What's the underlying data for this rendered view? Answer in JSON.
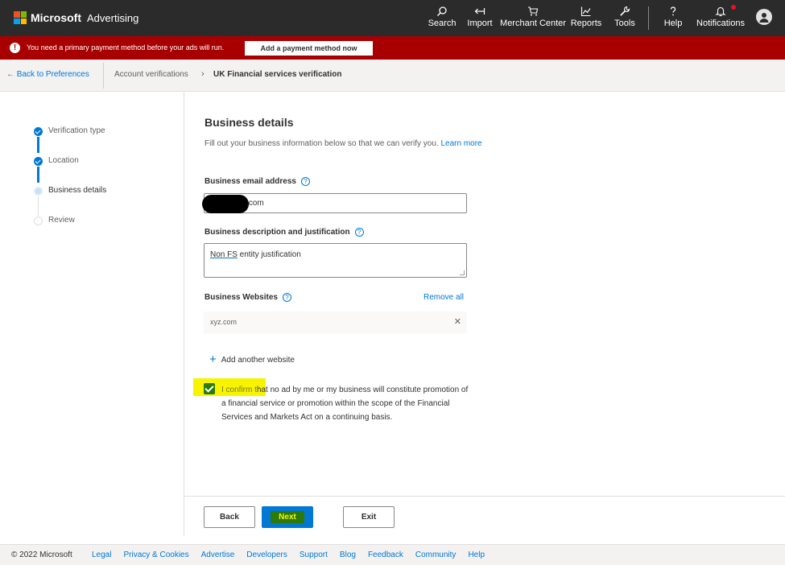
{
  "app": {
    "brand_ms": "Microsoft",
    "brand_product": "Advertising",
    "logo_colors": [
      "#f25022",
      "#7fba00",
      "#00a4ef",
      "#ffb900"
    ]
  },
  "nav": {
    "search": {
      "label": "Search",
      "icon": "search-icon"
    },
    "import": {
      "label": "Import",
      "icon": "import-icon"
    },
    "merchant": {
      "label": "Merchant Center",
      "icon": "cart-icon"
    },
    "reports": {
      "label": "Reports",
      "icon": "chart-icon"
    },
    "tools": {
      "label": "Tools",
      "icon": "wrench-icon"
    },
    "help": {
      "label": "Help",
      "icon": "question-icon"
    },
    "notifications": {
      "label": "Notifications",
      "icon": "bell-icon"
    }
  },
  "alert": {
    "message": "You need a primary payment method before your ads will run.",
    "button_label": "Add a payment method now",
    "color": "#a80000"
  },
  "breadcrumb": {
    "back_label": "Back to Preferences",
    "parent": "Account verifications",
    "current": "UK Financial services verification"
  },
  "steps": {
    "s1": "Verification type",
    "s2": "Location",
    "s3": "Business details",
    "s4": "Review"
  },
  "form": {
    "title": "Business details",
    "subtitle": "Fill out your business information below so that we can verify you.",
    "learn_more": "Learn more",
    "email_label": "Business email address",
    "email_value_visible": ".com",
    "description_label": "Business description and justification",
    "description_value_part1": "Non FS",
    "description_value_part2": " entity justification",
    "websites_label": "Business Websites",
    "remove_all": "Remove all",
    "website_value": "xyz.com",
    "add_website": "Add another website",
    "confirm_first": "I confirm t",
    "confirm_rest": "hat no ad by me or my business will constitute promotion of a financial service or promotion within the scope of the Financial Services and Markets Act on a continuing basis."
  },
  "buttons": {
    "back": "Back",
    "next": "Next",
    "exit": "Exit"
  },
  "footer": {
    "copyright": "© 2022 Microsoft",
    "links": [
      "Legal",
      "Privacy & Cookies",
      "Advertise",
      "Developers",
      "Support",
      "Blog",
      "Feedback",
      "Community",
      "Help"
    ]
  },
  "colors": {
    "accent": "#0078d4",
    "highlight": "#f8f400",
    "confirm_green": "#2b7a0b"
  }
}
